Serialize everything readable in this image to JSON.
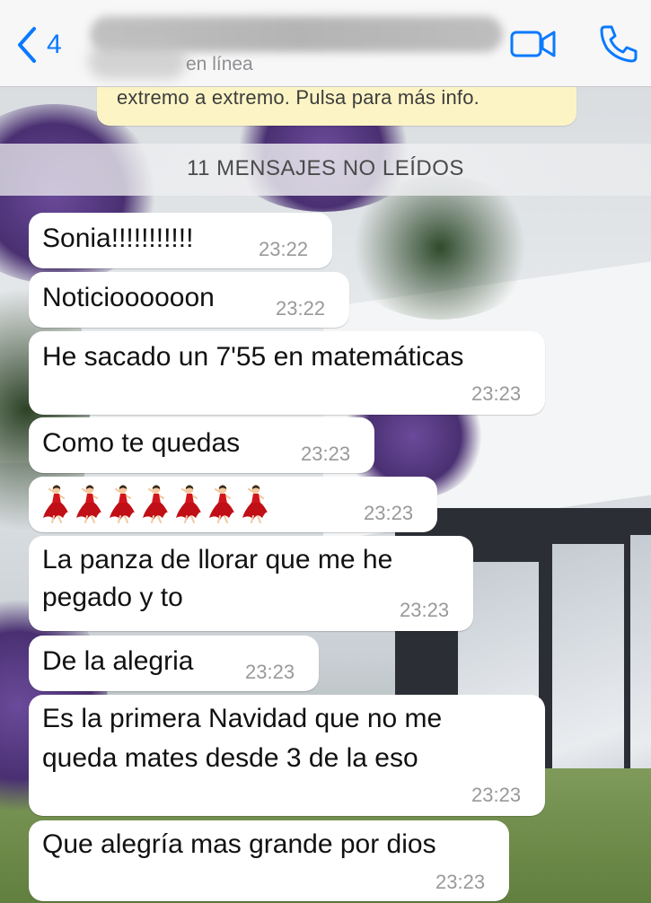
{
  "header": {
    "back_count": "4",
    "status": "en línea"
  },
  "encryption_banner": "extremo a extremo. Pulsa para más info.",
  "unread_divider": "11 MENSAJES NO LEÍDOS",
  "messages": [
    {
      "text": "Sonia!!!!!!!!!!!",
      "time": "23:22"
    },
    {
      "text": "Noticioooooon",
      "time": "23:22"
    },
    {
      "text": "He sacado un 7'55 en matemáticas",
      "time": "23:23"
    },
    {
      "text": "Como te quedas",
      "time": "23:23"
    },
    {
      "text": "💃💃💃💃💃💃💃",
      "time": "23:23",
      "emoji": "dancer",
      "count": 7
    },
    {
      "lines": [
        "La panza de llorar que me he",
        "pegado y to"
      ],
      "time": "23:23"
    },
    {
      "text": "De la alegria",
      "time": "23:23"
    },
    {
      "lines": [
        "Es la primera Navidad que no me",
        "queda mates desde 3 de la eso"
      ],
      "time": "23:23"
    },
    {
      "text": "Que alegría mas grande por dios",
      "time": "23:23"
    }
  ],
  "colors": {
    "accent": "#0a7aff",
    "bubble": "#ffffff",
    "banner": "#fdf4c5"
  },
  "icons": [
    "chevron-left-icon",
    "video-call-icon",
    "phone-icon",
    "dancer-emoji-icon"
  ]
}
